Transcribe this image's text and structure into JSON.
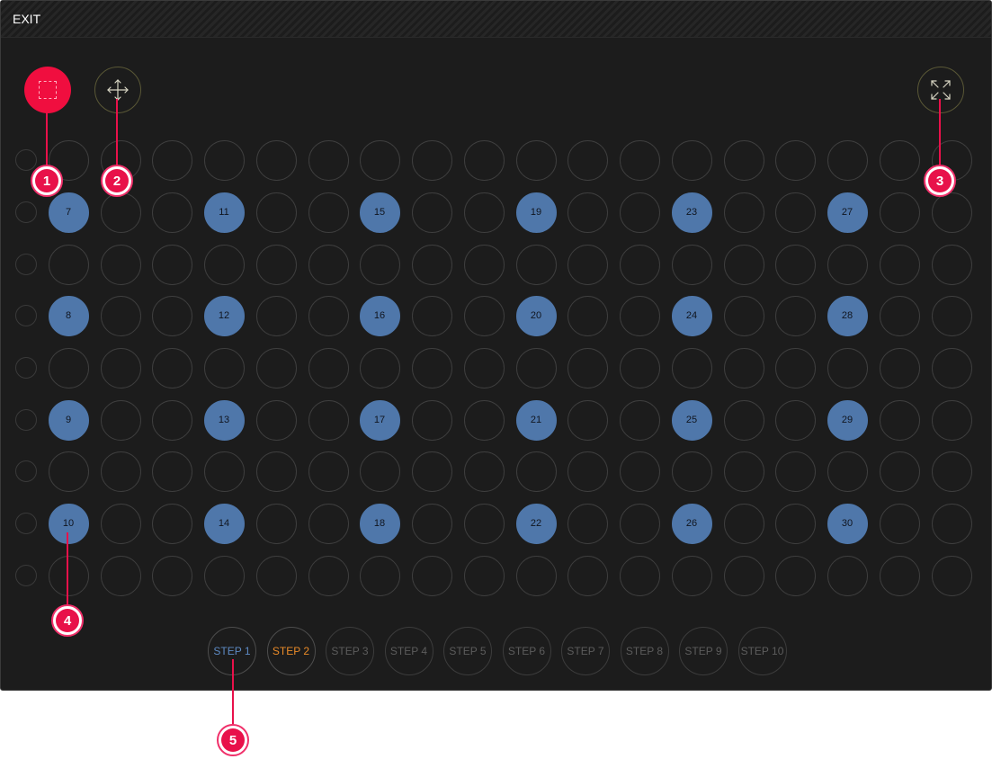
{
  "titlebar": {
    "exit_label": "EXIT"
  },
  "toolbar": {
    "select_icon": "selection-rectangle-icon",
    "move_icon": "move-arrows-icon",
    "fit_icon": "fit-to-screen-icon"
  },
  "seats": {
    "columns": [
      [
        "7",
        "8",
        "9",
        "10"
      ],
      [
        "11",
        "12",
        "13",
        "14"
      ],
      [
        "15",
        "16",
        "17",
        "18"
      ],
      [
        "19",
        "20",
        "21",
        "22"
      ],
      [
        "23",
        "24",
        "25",
        "26"
      ],
      [
        "27",
        "28",
        "29",
        "30"
      ]
    ]
  },
  "steps": {
    "labels": [
      "STEP 1",
      "STEP 2",
      "STEP 3",
      "STEP 4",
      "STEP 5",
      "STEP 6",
      "STEP 7",
      "STEP 8",
      "STEP 9",
      "STEP 10"
    ],
    "active_index": 0,
    "current_index": 1
  },
  "callouts": [
    "1",
    "2",
    "3",
    "4",
    "5"
  ],
  "colors": {
    "accent": "#f00e3f",
    "seat": "#4f77aa",
    "step_active": "#5d8ac4",
    "step_current": "#e98a28",
    "background": "#1c1c1c"
  }
}
